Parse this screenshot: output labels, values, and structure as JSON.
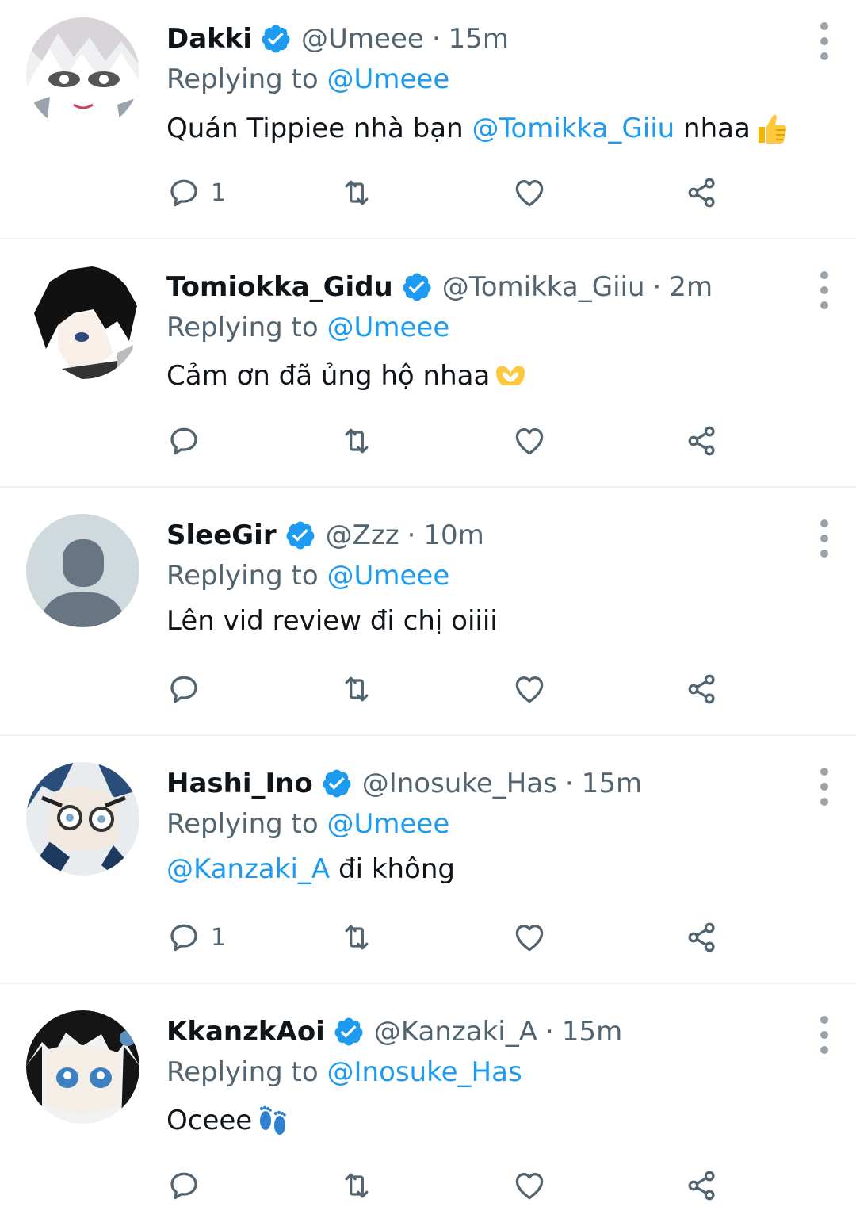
{
  "tweets": [
    {
      "name": "Dakki",
      "handle": "@Umeee",
      "time": "15m",
      "reply_label": "Replying to",
      "reply_to": "@Umeee",
      "body_mention": "",
      "body_text": "Quán Tippiee nhà bạn",
      "body_mention_mid": "@Tomikka_Giiu",
      "body_after": "nhaa",
      "emoji": "thumbs-up",
      "reply_count": "1",
      "avatar": "anime-white-hair"
    },
    {
      "name": "Tomiokka_Gidu",
      "handle": "@Tomikka_Giiu",
      "time": "2m",
      "reply_label": "Replying to",
      "reply_to": "@Umeee",
      "body_text": "Cảm ơn đã ủng hộ nhaa",
      "emoji": "heart-hands",
      "reply_count": "",
      "avatar": "anime-black-hair"
    },
    {
      "name": "SleeGir",
      "handle": "@Zzz",
      "time": "10m",
      "reply_label": "Replying to",
      "reply_to": "@Umeee",
      "body_text": "Lên vid review đi chị oiiii",
      "reply_count": "",
      "avatar": "default-person"
    },
    {
      "name": "Hashi_Ino",
      "handle": "@Inosuke_Has",
      "time": "15m",
      "reply_label": "Replying to",
      "reply_to": "@Umeee",
      "body_mention": "@Kanzaki_A",
      "body_text": "đi không",
      "reply_count": "1",
      "avatar": "anime-boar-mask"
    },
    {
      "name": "KkanzkAoi",
      "handle": "@Kanzaki_A",
      "time": "15m",
      "reply_label": "Replying to",
      "reply_to": "@Inosuke_Has",
      "body_text": "Oceee",
      "emoji": "footprints",
      "reply_count": "",
      "avatar": "anime-blue-eyes"
    }
  ],
  "separator": "·",
  "icons": {
    "verified": "verified-badge-icon",
    "reply": "reply-bubble-icon",
    "retweet": "retweet-icon",
    "like": "heart-icon",
    "share": "share-icon",
    "more": "more-vertical-icon"
  },
  "colors": {
    "accent": "#1d9bf0",
    "secondary_text": "#536471",
    "primary_text": "#0f1419",
    "divider": "#eff3f4"
  }
}
